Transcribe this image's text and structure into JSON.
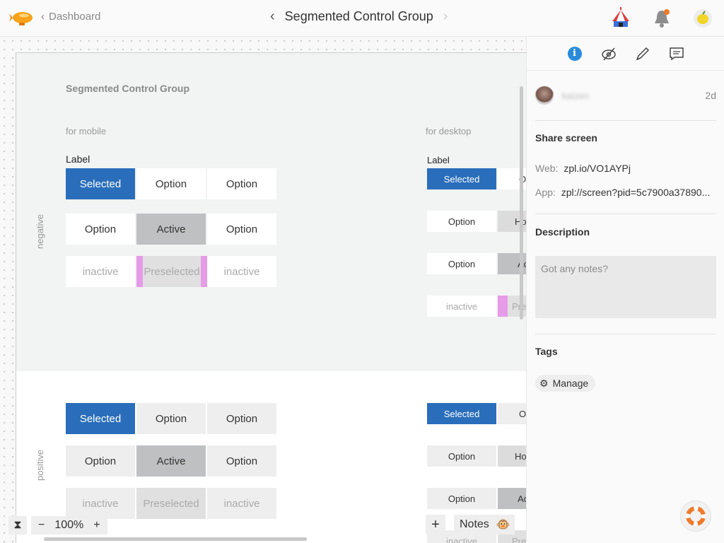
{
  "topbar": {
    "back_label": "Dashboard",
    "title": "Segmented Control Group"
  },
  "icons": {
    "logo": "zeppelin-logo-icon",
    "circus": "circus-tent-icon",
    "bell": "notification-bell-icon",
    "lemon": "lemon-avatar-icon"
  },
  "artboard": {
    "title": "Segmented Control Group",
    "mobile_label": "for mobile",
    "desktop_label": "for desktop",
    "field_label": "Label",
    "negative_label": "negative",
    "positive_label": "positive",
    "mobile_neg_row1": [
      "Selected",
      "Option",
      "Option"
    ],
    "mobile_neg_row2": [
      "Option",
      "Active",
      "Option"
    ],
    "mobile_neg_row3": [
      "inactive",
      "Preselected",
      "inactive"
    ],
    "mobile_pos_row1": [
      "Selected",
      "Option",
      "Option"
    ],
    "mobile_pos_row2": [
      "Option",
      "Active",
      "Option"
    ],
    "mobile_pos_row3": [
      "inactive",
      "Preselected",
      "inactive"
    ],
    "desktop_neg_row1": [
      "Selected",
      "Op"
    ],
    "desktop_neg_row2": [
      "Option",
      "Ho"
    ],
    "desktop_neg_row3": [
      "Option",
      "Ac"
    ],
    "desktop_neg_row4": [
      "inactive",
      "Pres"
    ],
    "desktop_pos_row1": [
      "Selected",
      "Op"
    ],
    "desktop_pos_row2": [
      "Option",
      "Ho"
    ],
    "desktop_pos_row3": [
      "Option",
      "Ac"
    ],
    "desktop_pos_row4": [
      "inactive",
      "Pres"
    ]
  },
  "bottom": {
    "zoom_out": "−",
    "zoom_level": "100%",
    "zoom_in": "+",
    "add": "+",
    "notes_label": "Notes",
    "notes_emoji": "🐵"
  },
  "panel": {
    "user_name": "kaizen",
    "age": "2d",
    "share_title": "Share screen",
    "web_key": "Web:",
    "web_value": "zpl.io/VO1AYPj",
    "app_key": "App:",
    "app_value": "zpl://screen?pid=5c7900a37890...",
    "description_title": "Description",
    "notes_placeholder": "Got any notes?",
    "tags_title": "Tags",
    "manage_label": "Manage"
  },
  "colors": {
    "selected": "#2a6ebb",
    "active": "#bfc0c2",
    "preselected_marker": "#e59be6",
    "info_blue": "#2a8bdb"
  }
}
